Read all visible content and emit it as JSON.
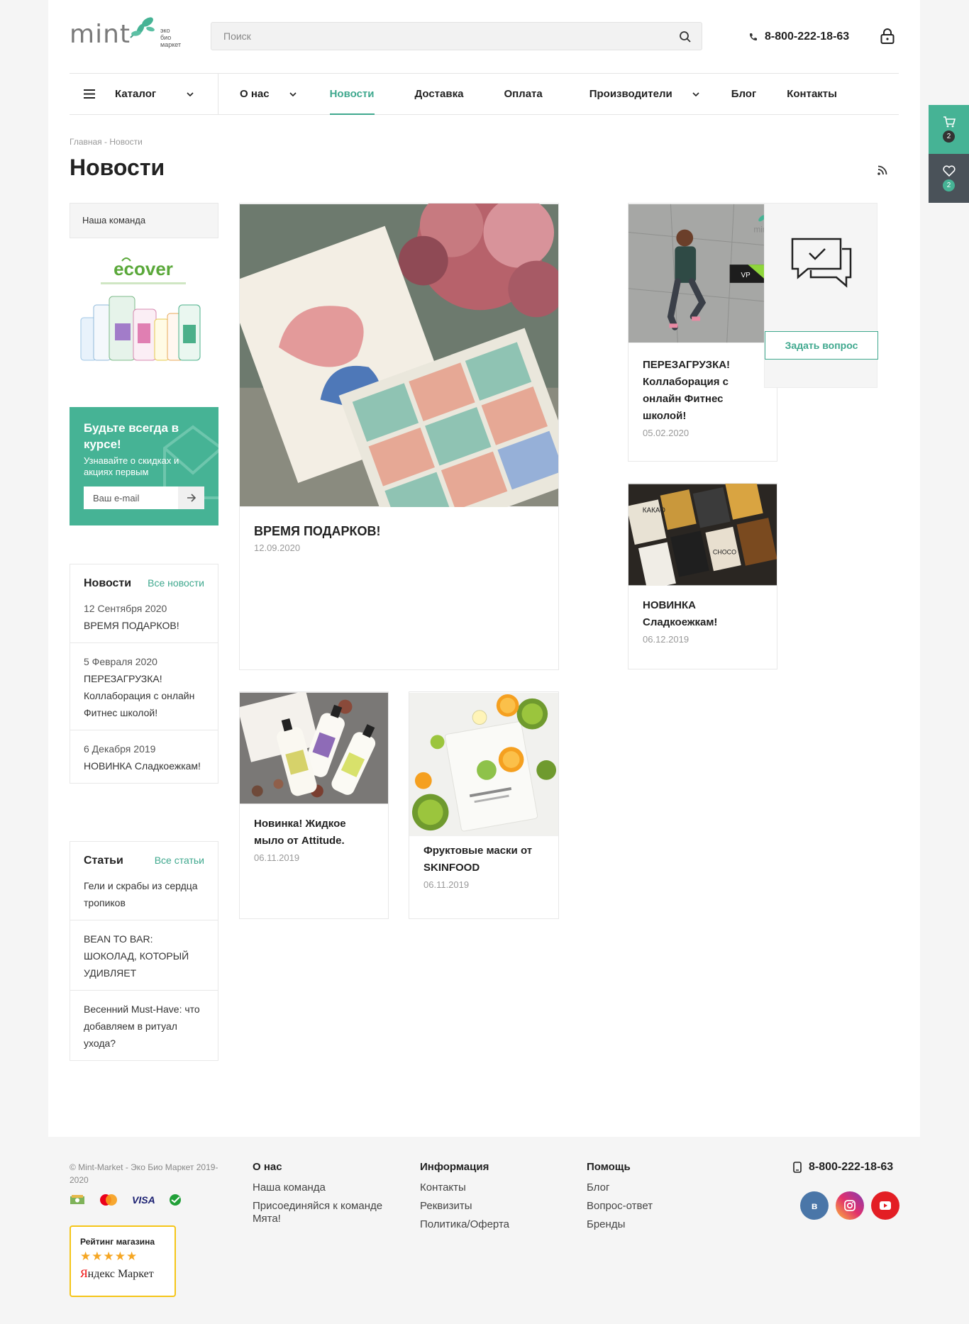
{
  "header": {
    "logo_text": "mint",
    "logo_sub": [
      "эко",
      "био",
      "маркет"
    ],
    "search_placeholder": "Поиск",
    "phone": "8-800-222-18-63"
  },
  "nav": {
    "catalog": "Каталог",
    "items": [
      {
        "label": "О нас",
        "has_dropdown": true
      },
      {
        "label": "Новости",
        "active": true
      },
      {
        "label": "Доставка"
      },
      {
        "label": "Оплата"
      },
      {
        "label": "Производители",
        "has_dropdown": true
      },
      {
        "label": "Блог"
      },
      {
        "label": "Контакты"
      }
    ]
  },
  "side_tabs": {
    "cart_count": "2",
    "wishlist_count": "2"
  },
  "breadcrumb": [
    "Главная",
    "Новости"
  ],
  "page_title": "Новости",
  "left": {
    "menu_item": "Наша команда",
    "subscribe": {
      "title": "Будьте всегда в курсе!",
      "text": "Узнавайте о скидках и акциях первым",
      "placeholder": "Ваш e-mail"
    },
    "news_widget": {
      "title": "Новости",
      "link": "Все новости",
      "items": [
        {
          "date": "12 Сентября 2020",
          "title": "ВРЕМЯ ПОДАРКОВ!"
        },
        {
          "date": "5 Февраля 2020",
          "title": "ПЕРЕЗАГРУЗКА! Коллаборация с онлайн Фитнес школой!"
        },
        {
          "date": "6 Декабря 2019",
          "title": "НОВИНКА Сладкоежкам!"
        }
      ]
    },
    "articles_widget": {
      "title": "Статьи",
      "link": "Все статьи",
      "items": [
        "Гели и скрабы из сердца тропиков",
        "BEAN TO BAR: ШОКОЛАД, КОТОРЫЙ УДИВЛЯЕТ",
        "Весенний Must-Have: что добавляем в ритуал ухода?"
      ]
    }
  },
  "news": [
    {
      "title": "ВРЕМЯ ПОДАРКОВ!",
      "date": "12.09.2020"
    },
    {
      "title": "ПЕРЕЗАГРУЗКА! Коллаборация с онлайн Фитнес школой!",
      "date": "05.02.2020"
    },
    {
      "title": "НОВИНКА Сладкоежкам!",
      "date": "06.12.2019"
    },
    {
      "title": "Новинка! Жидкое мыло от Attitude.",
      "date": "06.11.2019"
    },
    {
      "title": "Фруктовые маски от SKINFOOD",
      "date": "06.11.2019"
    }
  ],
  "ask": {
    "button": "Задать вопрос"
  },
  "footer": {
    "copyright": "© Mint-Market - Эко Био Маркет 2019- 2020",
    "rating_title": "Рейтинг магазина",
    "rating_stars": "★★★★★",
    "rating_brand_red": "Я",
    "rating_brand_rest": "ндекс Маркет",
    "col1": {
      "title": "О нас",
      "links": [
        "Наша команда",
        "Присоединяйся к команде Мята!"
      ]
    },
    "col2": {
      "title": "Информация",
      "links": [
        "Контакты",
        "Реквизиты",
        "Политика/Оферта"
      ]
    },
    "col3": {
      "title": "Помощь",
      "links": [
        "Блог",
        "Вопрос-ответ",
        "Бренды"
      ]
    },
    "phone": "8-800-222-18-63",
    "social": {
      "vk": "в"
    },
    "payment": {
      "visa": "VISA"
    }
  },
  "colors": {
    "accent": "#46b395",
    "dark": "#4a5259"
  }
}
